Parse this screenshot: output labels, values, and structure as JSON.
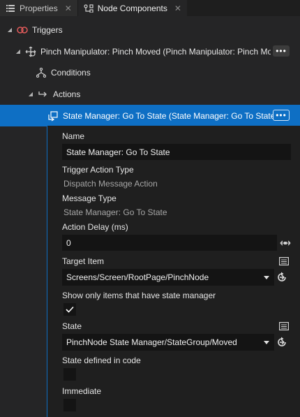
{
  "tabs": [
    {
      "label": "Properties",
      "close": "✕"
    },
    {
      "label": "Node Components",
      "close": "✕"
    }
  ],
  "tree": {
    "triggers": "Triggers",
    "trigger": "Pinch Manipulator: Pinch Moved (Pinch Manipulator: Pinch Mo",
    "conditions": "Conditions",
    "actions": "Actions",
    "action": "State Manager: Go To State (State Manager: Go To State)",
    "more": "•••"
  },
  "props": {
    "name_label": "Name",
    "name_value": "State Manager: Go To State",
    "trigger_action_type_label": "Trigger Action Type",
    "trigger_action_type_value": "Dispatch Message Action",
    "message_type_label": "Message Type",
    "message_type_value": "State Manager: Go To State",
    "action_delay_label": "Action Delay (ms)",
    "action_delay_value": "0",
    "target_item_label": "Target Item",
    "target_item_value": "Screens/Screen/RootPage/PinchNode",
    "show_only_label": "Show only items that have state manager",
    "show_only_checked": true,
    "state_label": "State",
    "state_value": "PinchNode State Manager/StateGroup/Moved",
    "state_defined_label": "State defined in code",
    "state_defined_checked": false,
    "immediate_label": "Immediate",
    "immediate_checked": false
  },
  "colors": {
    "accent": "#0e6fc4",
    "trigger_icon": "#e05a5a"
  }
}
